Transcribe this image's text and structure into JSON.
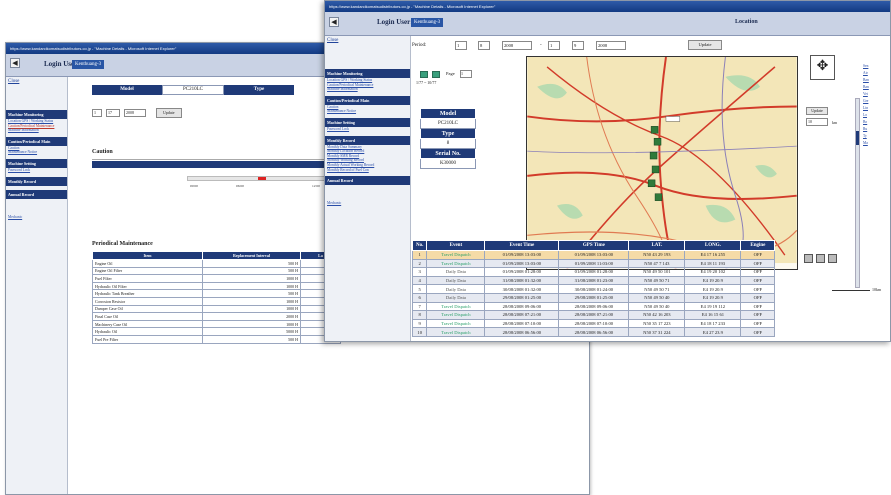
{
  "back_window": {
    "title": "https://www.kandarcikomatsudistributors.co.jp - \"Machine Details - Microsoft Internet Explorer\"",
    "login_label": "Login User:",
    "login_value": "Kenthuang-3",
    "sidebar": {
      "close": "Close",
      "machine_monitoring": "Machine Monitoring",
      "monitoring_links": [
        "Location GPS / Working Status",
        "Caution/Periodical Maintenance",
        "Machine Information"
      ],
      "caution_section": "Caution/Periodical Main",
      "caution_links": [
        "Caution",
        "Maintenance Notice"
      ],
      "setting_section": "Machine Setting",
      "setting_links": [
        "Password Lock"
      ],
      "monthly": "Monthly Record",
      "annual": "Annual Record",
      "logout": "Mechanic"
    },
    "model_label": "Model",
    "model_value": "PC210LC",
    "type_label": "Type",
    "date_fields": [
      "1",
      "17",
      "2008"
    ],
    "update_button": "Update",
    "caution_title": "Caution",
    "times_label": "Times of C",
    "timeline_labels": [
      "00:00",
      "06:00",
      "12:00"
    ],
    "pm_title": "Periodical Maintenance",
    "pm_headers": [
      "Item",
      "Replacement Interval",
      "La"
    ],
    "pm_rows": [
      [
        "Engine Oil",
        "500 H"
      ],
      [
        "Engine Oil Filter",
        "500 H"
      ],
      [
        "Fuel Filter",
        "1000 H"
      ],
      [
        "Hydraulic Oil Filter",
        "1000 H"
      ],
      [
        "Hydraulic Tank Breather",
        "500 H"
      ],
      [
        "Corrosion Resistor",
        "1000 H"
      ],
      [
        "Damper Case Oil",
        "1000 H"
      ],
      [
        "Final Case Oil",
        "2000 H"
      ],
      [
        "Machinery Case Oil",
        "1000 H"
      ],
      [
        "Hydraulic Oil",
        "5000 H"
      ],
      [
        "Fuel Pre Filter",
        "500 H"
      ]
    ]
  },
  "front_window": {
    "title": "https://www.kandarcikomatsudistributors.co.jp - \"Machine Details - Microsoft Internet Explorer\"",
    "login_label": "Login User:",
    "login_value": "Kenthuang-3",
    "location_title": "Location",
    "sidebar": {
      "close": "Close",
      "machine_monitoring": "Machine Monitoring",
      "monitoring_links": [
        "Location GPS / Working Status",
        "Caution/Periodical Maintenance",
        "Machine Information"
      ],
      "caution_section": "Caution/Periodical Main",
      "caution_links": [
        "Caution",
        "Maintenance Notice"
      ],
      "setting_section": "Machine Setting",
      "setting_links": [
        "Password Lock"
      ],
      "monthly": "Monthly Record",
      "monthly_links": [
        "Monthly Data Summary",
        "Monthly Location Record",
        "Monthly SMR Record",
        "Monthly Working Record",
        "Monthly Actual Working Record",
        "Monthly Record of Fuel Con"
      ],
      "annual": "Annual Record",
      "logout": "Mechanic"
    },
    "period_label": "Period:",
    "period_from": [
      "1",
      "8",
      "2008"
    ],
    "period_sep": "-",
    "period_to": [
      "1",
      "9",
      "2008"
    ],
    "update_button": "Update",
    "page_label": "Page",
    "page_value": "1",
    "range_text": "1/77 ~ 10/77",
    "model_label": "Model",
    "model_value": "PC210LC",
    "type_label": "Type",
    "type_value": "8",
    "serial_label": "Serial No.",
    "serial_value": "K30000",
    "zoom_update": "Update",
    "km_value": "10",
    "km_unit": "km",
    "legend_links": [
      "Sen",
      "Air",
      "Ban",
      "Ban",
      "Vet",
      "Gre",
      "Lin",
      "Lo",
      "Bo",
      "Ru",
      "Ty",
      "Ma"
    ],
    "scale_label": "10km",
    "grid_headers": [
      "No.",
      "Event",
      "Event Time",
      "GPS Time",
      "LAT.",
      "LONG.",
      "Engine"
    ],
    "grid_rows": [
      [
        "1",
        "Travel Dispatch",
        "01/09/2008 13:03:00",
        "01/09/2008 13:03:00",
        "N50 43 29 193",
        "E4 17 16 255",
        "OFF"
      ],
      [
        "2",
        "Travel Dispatch",
        "01/09/2008 13:03:00",
        "01/09/2008 11:03:00",
        "N50 47 7 143",
        "E4 18 11 193",
        "OFF"
      ],
      [
        "3",
        "Daily Data",
        "01/09/2008 01:28:00",
        "01/09/2008 01:28:00",
        "N50 49 50 101",
        "E4 19 20 102",
        "OFF"
      ],
      [
        "4",
        "Daily Data",
        "31/08/2008 01:32:00",
        "31/08/2008 01:23:00",
        "N50 49 50 71",
        "E4 19 20.9",
        "OFF"
      ],
      [
        "5",
        "Daily Data",
        "30/08/2008 01:32:00",
        "30/08/2008 01:24:00",
        "N50 49 50 71",
        "E4 19 20.9",
        "OFF"
      ],
      [
        "6",
        "Daily Data",
        "29/08/2008 01:25:00",
        "29/08/2008 01:25:00",
        "N50 49 50 40",
        "E4 19 20.9",
        "OFF"
      ],
      [
        "7",
        "Travel Dispatch",
        "28/08/2008 09:06:00",
        "28/08/2008 09:06:00",
        "N50 49 50 40",
        "E4 19 19 112",
        "OFF"
      ],
      [
        "8",
        "Travel Dispatch",
        "28/08/2008 07:21:00",
        "28/08/2008 07:21:00",
        "N50 42 16 203",
        "E4 16 15 61",
        "OFF"
      ],
      [
        "9",
        "Travel Dispatch",
        "28/08/2008 07:10:00",
        "28/08/2008 07:10:00",
        "N50 35 17 223",
        "E4 18 17 233",
        "OFF"
      ],
      [
        "10",
        "Travel Dispatch",
        "28/08/2008 06:56:00",
        "28/08/2008 06:56:00",
        "N50 37 31 224",
        "E4 27 23.9",
        "OFF"
      ]
    ]
  },
  "colors": {
    "header_navy": "#1f3a78",
    "titlebar_blue": "#123a82",
    "highlight_row": "#f5dba7",
    "map_bg": "#f3e6b8",
    "road_red": "#d23b2a"
  }
}
